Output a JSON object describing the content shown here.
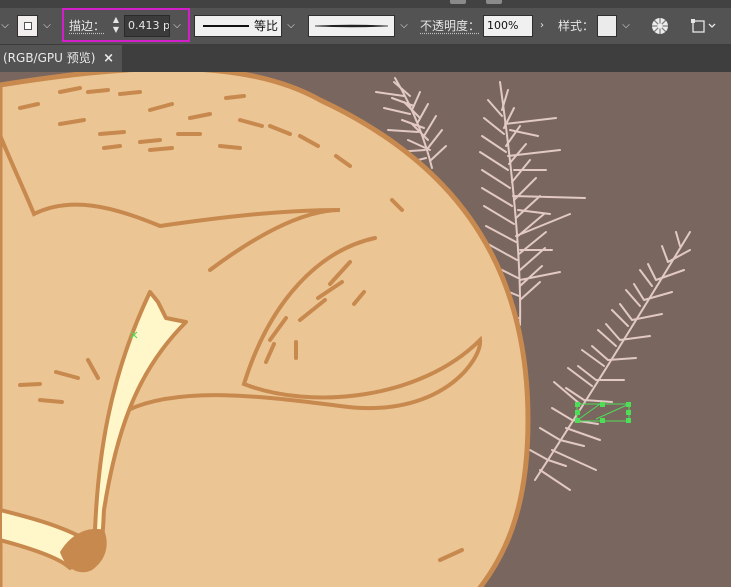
{
  "control_bar": {
    "stroke_label": "描边：",
    "stroke_value": "0.413 p",
    "stroke_profile_label": "等比",
    "opacity_label": "不透明度：",
    "opacity_value": "100%",
    "style_label": "样式：",
    "swatch_color": "#f3e6e6"
  },
  "document_tab": {
    "title": "(RGB/GPU 预览)",
    "close_glyph": "×"
  },
  "artwork": {
    "canvas_background": "#79665f",
    "fox_fill": "#ecc594",
    "fox_outline": "#c7894e",
    "tail_tip_fill": "#fff6c9",
    "grass_color": "#e3c9c4",
    "selection_color": "#4fdc57"
  }
}
